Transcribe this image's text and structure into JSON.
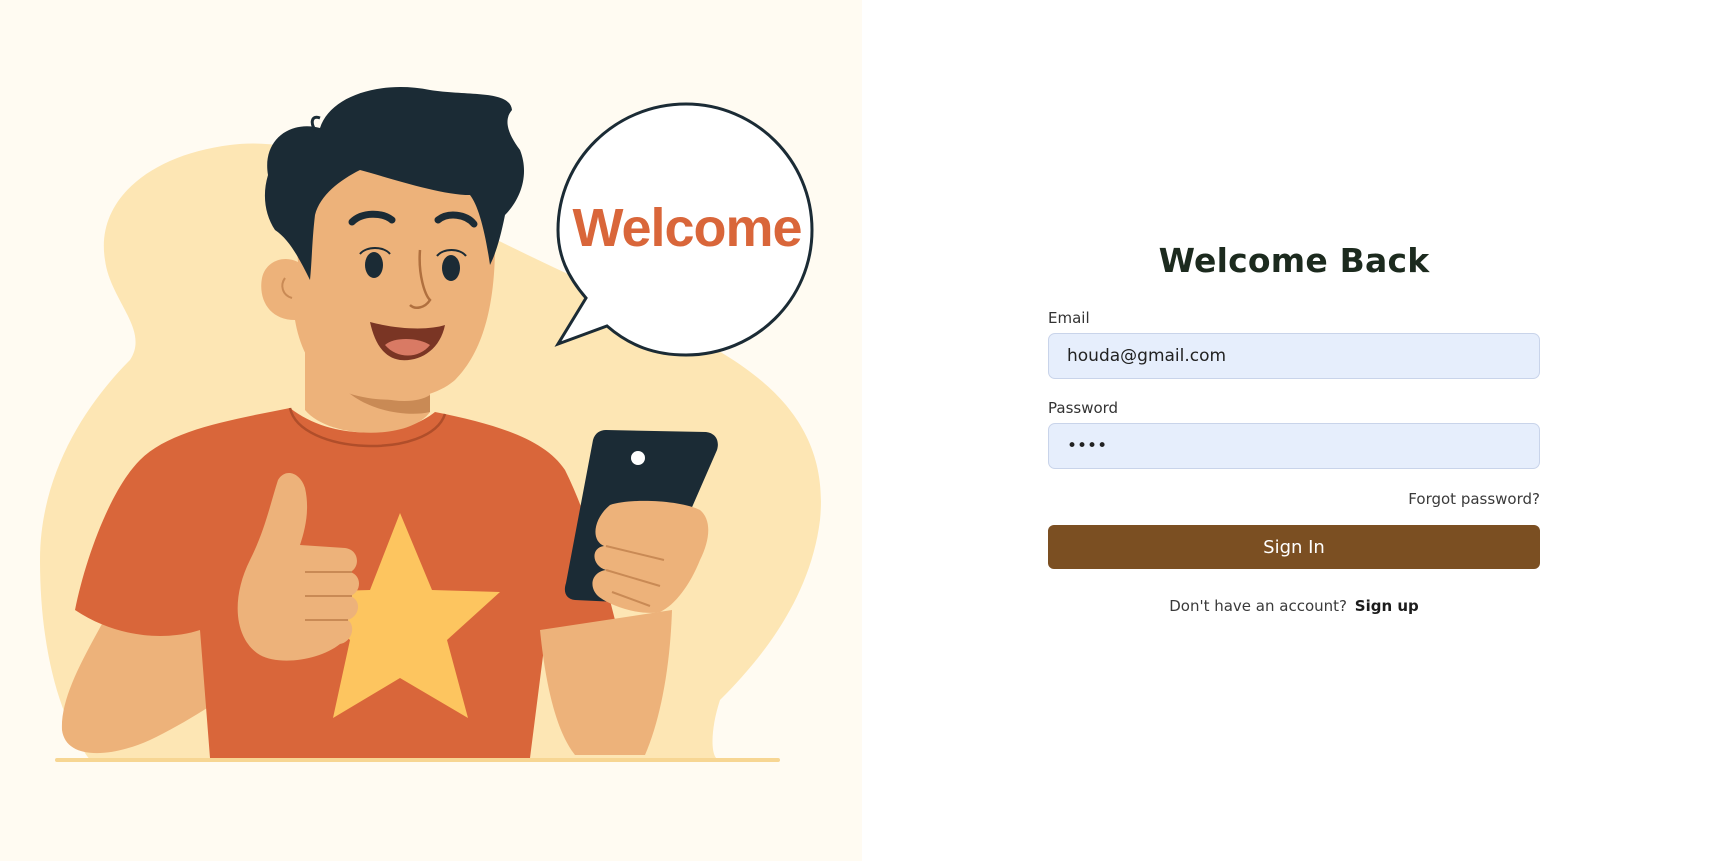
{
  "illustration": {
    "speech_bubble_text": "Welcome",
    "colors": {
      "background": "#fffbf2",
      "blob": "#fde6b4",
      "shirt": "#d9663a",
      "skin": "#edb27a",
      "hair": "#1b2b35",
      "star": "#fdc55f",
      "bubble_text": "#d9663a"
    }
  },
  "login": {
    "title": "Welcome Back",
    "email": {
      "label": "Email",
      "value": "houda@gmail.com"
    },
    "password": {
      "label": "Password",
      "value": "••••"
    },
    "forgot_password": "Forgot password?",
    "sign_in_button": "Sign In",
    "signup_prompt": "Don't have an account?",
    "signup_link": "Sign up",
    "colors": {
      "button": "#7b4f22",
      "input_background": "#e6eefc"
    }
  }
}
